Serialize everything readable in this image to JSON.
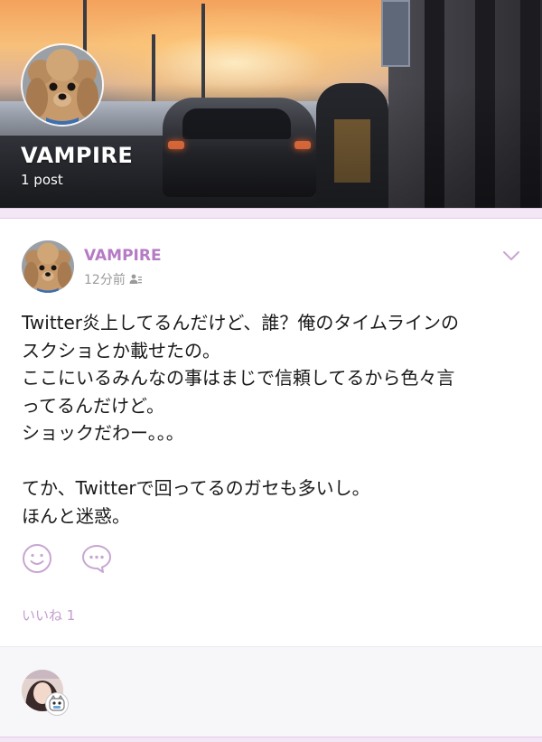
{
  "profile": {
    "name": "VAMPIRE",
    "post_count": "1 post",
    "avatar_icon": "poodle-dog-avatar"
  },
  "post": {
    "author": "VAMPIRE",
    "time": "12分前",
    "audience_icon": "friends-icon",
    "menu_icon": "chevron-down-icon",
    "body": "Twitter炎上してるんだけど、誰？俺のタイムラインの\nスクショとか載せたの。\nここにいるみんなの事はまじで信頼してるから色々言\nってるんだけど。\nショックだわー。。。\n\nてか、Twitterで回ってるのガセも多いし。\nほんと迷惑。",
    "reactions": [
      {
        "icon": "smile-icon"
      },
      {
        "icon": "comment-icon"
      }
    ],
    "likes_label": "いいね 1"
  },
  "colors": {
    "accent": "#b57bc4",
    "accent_light": "#f3e6f5",
    "likes_text": "#c49ed0",
    "body_text": "#1a1a1a",
    "meta_text": "#9a9a9a"
  },
  "comments": {
    "avatar_icon": "user-photo-avatar",
    "badge_icon": "character-badge-icon"
  }
}
